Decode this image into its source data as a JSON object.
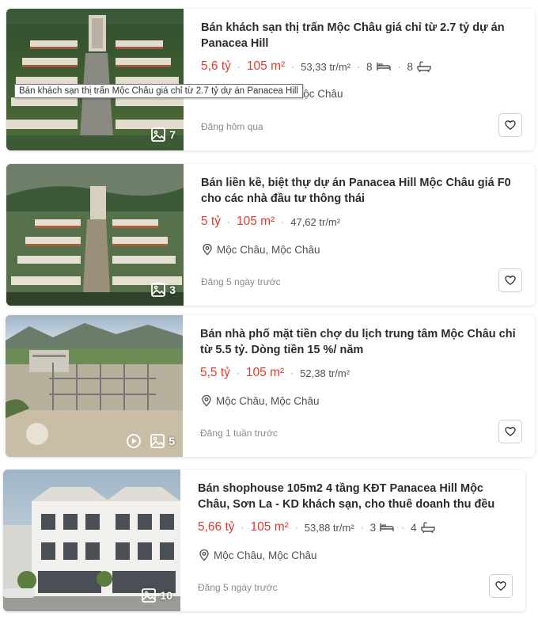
{
  "tooltip": "Bán khách sạn thị trấn Mộc Châu giá chỉ từ 2.7 tỷ dự án Panacea Hill",
  "listings": [
    {
      "title": "Bán khách sạn thị trấn Mộc Châu giá chỉ từ 2.7 tỷ dự án Panacea Hill",
      "price": "5,6 tỷ",
      "area": "105 m²",
      "price_per_m2": "53,33 tr/m²",
      "bedrooms": "8",
      "bathrooms": "8",
      "location": "Mộc Châu, Mộc Châu",
      "location_visible": "Mộc Châu",
      "posted": "Đăng hôm qua",
      "media_count": "7",
      "icons": {
        "media": "image-icon",
        "bed": "bed-icon",
        "bath": "bath-icon",
        "location": "location-pin-icon",
        "save": "heart-icon"
      }
    },
    {
      "title": "Bán liền kề, biệt thự dự án Panacea Hill Mộc Châu giá F0 cho các nhà đầu tư thông thái",
      "price": "5 tỷ",
      "area": "105 m²",
      "price_per_m2": "47,62 tr/m²",
      "location": "Mộc Châu, Mộc Châu",
      "posted": "Đăng 5 ngày trước",
      "media_count": "3"
    },
    {
      "title": "Bán nhà phố mặt tiền chợ du lịch trung tâm Mộc Châu chỉ từ 5.5 tỷ. Dòng tiền 15 %/ năm",
      "price": "5,5 tỷ",
      "area": "105 m²",
      "price_per_m2": "52,38 tr/m²",
      "location": "Mộc Châu, Mộc Châu",
      "posted": "Đăng 1 tuần trước",
      "media_count": "5",
      "has_video": true
    },
    {
      "title": "Bán shophouse 105m2 4 tầng KĐT Panacea Hill Mộc Châu, Sơn La - KD khách sạn, cho thuê doanh thu đều",
      "price": "5,66 tỷ",
      "area": "105 m²",
      "price_per_m2": "53,88 tr/m²",
      "bedrooms": "3",
      "bathrooms": "4",
      "location": "Mộc Châu, Mộc Châu",
      "posted": "Đăng 5 ngày trước",
      "media_count": "10"
    }
  ],
  "colors": {
    "price": "#e03c31",
    "text": "#2c2c2c",
    "muted": "#8a8a8a"
  }
}
